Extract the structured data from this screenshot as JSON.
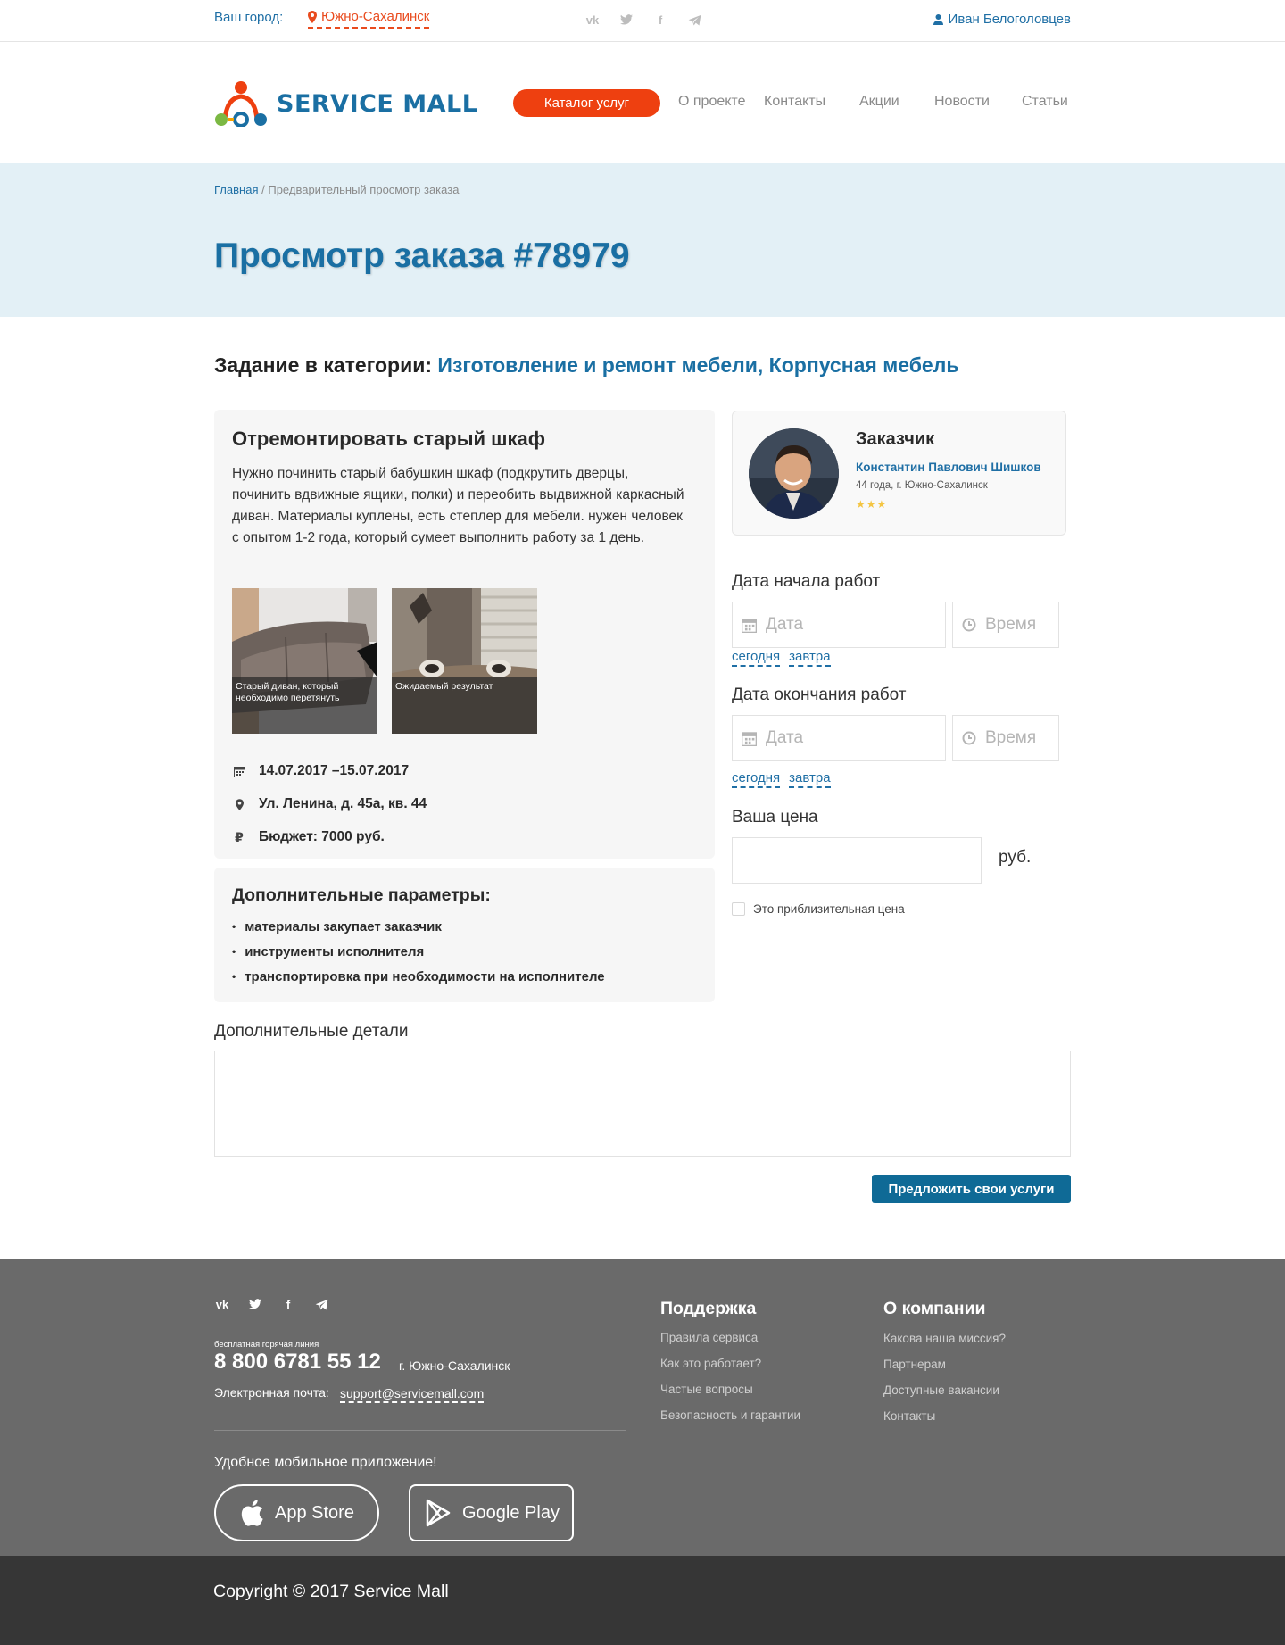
{
  "topbar": {
    "city_label": "Ваш город:",
    "city": "Южно-Сахалинск",
    "user": "Иван Белоголовцев",
    "socials": [
      "vk-icon",
      "twitter-icon",
      "facebook-icon",
      "telegram-icon"
    ]
  },
  "header": {
    "logo": "SERVICE MALL",
    "catalog_button": "Каталог услуг",
    "nav": [
      "О проекте",
      "Контакты",
      "Акции",
      "Новости",
      "Статьи"
    ]
  },
  "breadcrumb": {
    "home": "Главная",
    "separator": "/",
    "current": "Предварительный просмотр заказа"
  },
  "page_title": "Просмотр заказа #78979",
  "category": {
    "label": "Задание в категории:",
    "value": "Изготовление и ремонт мебели, Корпусная мебель"
  },
  "task": {
    "title": "Отремонтировать старый шкаф",
    "description": "Нужно починить старый бабушкин шкаф (подкрутить дверцы, починить вдвижные ящики, полки) и переобить выдвижной каркасный диван. Материалы куплены, есть степлер для мебели. нужен человек с опытом 1-2 года, который сумеет выполнить работу за 1 день.",
    "photos": [
      {
        "caption": "Старый диван, который необходимо перетянуть"
      },
      {
        "caption": "Ожидаемый результат"
      }
    ],
    "dates": "14.07.2017 –15.07.2017",
    "address": "Ул. Ленина, д. 45а, кв. 44",
    "budget": "Бюджет: 7000 руб."
  },
  "params": {
    "title": "Дополнительные параметры:",
    "items": [
      "материалы закупает заказчик",
      "инструменты исполнителя",
      "транспортировка при необходимости на исполнителе"
    ]
  },
  "customer": {
    "label": "Заказчик",
    "name": "Константин Павлович Шишков",
    "info": "44 года, г. Южно-Сахалинск",
    "stars": "★★★"
  },
  "form": {
    "start_label": "Дата начала работ",
    "end_label": "Дата окончания работ",
    "date_placeholder": "Дата",
    "time_placeholder": "Время",
    "today": "сегодня",
    "tomorrow": "завтра",
    "price_label": "Ваша цена",
    "price_value": "",
    "currency": "руб.",
    "approx_label": "Это приблизительная цена",
    "details_label": "Дополнительные детали",
    "details_value": "",
    "submit": "Предложить свои услуги"
  },
  "footer": {
    "socials": [
      "vk-icon",
      "twitter-icon",
      "facebook-icon",
      "telegram-icon"
    ],
    "hotline_label": "бесплатная  горячая линия",
    "phone": "8 800 6781 55 12",
    "city": "г. Южно-Сахалинск",
    "email_label": "Электронная почта:",
    "email": "support@servicemall.com",
    "app_label": "Удобное мобильное приложение!",
    "app_store": "App Store",
    "google_play": "Google Play",
    "support_title": "Поддержка",
    "support_links": [
      "Правила сервиса",
      "Как это работает?",
      "Частые вопросы",
      "Безопасность и гарантии"
    ],
    "company_title": "О компании",
    "company_links": [
      "Какова наша миссия?",
      "Партнерам",
      "Доступные вакансии",
      "Контакты"
    ],
    "copyright": "Copyright © 2017 Service Mall"
  },
  "colors": {
    "brand_blue": "#1a6fa3",
    "accent_orange": "#ee4010",
    "button_blue": "#0f6a96",
    "banner_bg": "#e3f0f6",
    "footer_bg": "#6a6a6a"
  }
}
